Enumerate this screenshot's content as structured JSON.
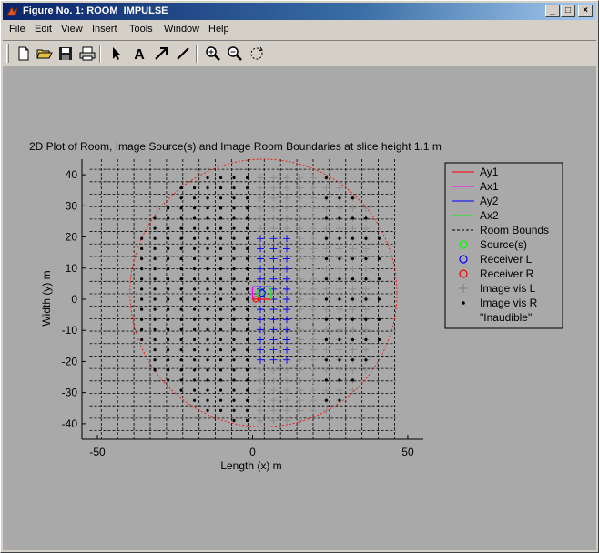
{
  "window": {
    "title": "Figure No. 1: ROOM_IMPULSE",
    "minimize_label": "_",
    "maximize_label": "□",
    "close_label": "×"
  },
  "menu": [
    {
      "label": "File"
    },
    {
      "label": "Edit"
    },
    {
      "label": "View"
    },
    {
      "label": "Insert"
    },
    {
      "label": "Tools"
    },
    {
      "label": "Window"
    },
    {
      "label": "Help"
    }
  ],
  "toolbar": [
    {
      "icon": "new-file-icon"
    },
    {
      "icon": "open-folder-icon"
    },
    {
      "icon": "save-disk-icon"
    },
    {
      "icon": "print-icon"
    },
    {
      "icon": "select-arrow-icon"
    },
    {
      "icon": "insert-text-icon"
    },
    {
      "icon": "insert-arrow-icon"
    },
    {
      "icon": "insert-line-icon"
    },
    {
      "icon": "zoom-in-icon"
    },
    {
      "icon": "zoom-out-icon"
    },
    {
      "icon": "rotate-icon"
    }
  ],
  "chart_data": {
    "type": "scatter",
    "title": "2D Plot of Room, Image Source(s) and Image Room Boundaries at slice height 1.1 m",
    "xlabel": "Length (x) m",
    "ylabel": "Width (y) m",
    "xlim": [
      -55,
      55
    ],
    "ylim": [
      -45,
      45
    ],
    "xticks": [
      -50,
      0,
      50
    ],
    "yticks": [
      -40,
      -30,
      -20,
      -10,
      0,
      10,
      20,
      30,
      40
    ],
    "grid": false,
    "legend_position": "outside-right",
    "room_bounds": {
      "x_lines": [
        -48.75,
        -43.5,
        -38.25,
        -33,
        -27.75,
        -22.5,
        -17.25,
        -12,
        -6.75,
        -1.5,
        3.75,
        9,
        14.25,
        19.5,
        24.75,
        30,
        35.25,
        40.5,
        45.75
      ],
      "y_lines": [
        -42.25,
        -38.25,
        -34.25,
        -30.25,
        -26.25,
        -22.25,
        -18.25,
        -14.25,
        -10.25,
        -6.25,
        -2.25,
        1.75,
        5.75,
        9.75,
        13.75,
        17.75,
        21.75,
        25.75,
        29.75,
        33.75,
        37.75,
        41.75
      ]
    },
    "circle": {
      "cx": 3.5,
      "cy": 2,
      "r": 43
    },
    "boundary_segments": {
      "Ay1": {
        "x": [
          0,
          6
        ],
        "y": [
          0,
          0
        ]
      },
      "Ax1": {
        "x": [
          0,
          0
        ],
        "y": [
          0,
          4
        ]
      },
      "Ay2": {
        "x": [
          0,
          6
        ],
        "y": [
          4,
          4
        ]
      },
      "Ax2": {
        "x": [
          6,
          6
        ],
        "y": [
          0,
          4
        ]
      }
    },
    "source": {
      "x": 2.5,
      "y": 2
    },
    "receiver_l": {
      "x": 3,
      "y": 2
    },
    "receiver_r": {
      "x": 1,
      "y": 0
    },
    "image_grid": {
      "x_start": -40,
      "x_step": 4.25,
      "x_count": 20,
      "y_start": -39,
      "y_step": 3.25,
      "y_count": 25,
      "plus_x_range": [
        0,
        40
      ]
    },
    "legend": [
      {
        "label": "Ay1",
        "color": "#ff0000",
        "symbol": "line"
      },
      {
        "label": "Ax1",
        "color": "#ff00ff",
        "symbol": "line"
      },
      {
        "label": "Ay2",
        "color": "#0000ff",
        "symbol": "line"
      },
      {
        "label": "Ax2",
        "color": "#00ff00",
        "symbol": "line"
      },
      {
        "label": "Room Bounds",
        "color": "#000000",
        "symbol": "dash"
      },
      {
        "label": "Source(s)",
        "color": "#00ff00",
        "symbol": "circle"
      },
      {
        "label": "Receiver L",
        "color": "#0000ff",
        "symbol": "circle"
      },
      {
        "label": "Receiver R",
        "color": "#ff0000",
        "symbol": "circle"
      },
      {
        "label": "Image vis L",
        "color": "#808080",
        "symbol": "plus"
      },
      {
        "label": "Image vis R",
        "color": "#000000",
        "symbol": "dot"
      },
      {
        "label": "\"Inaudible\"",
        "color": "#000000",
        "symbol": "none"
      }
    ],
    "colors": {
      "axes_bg": "#a9a9a9",
      "figure_bg": "#a9a9a9",
      "plus_gray": "#8a8a8a",
      "plus_blue": "#0000ff",
      "dot": "#000000",
      "circle": "#ff0000"
    }
  }
}
